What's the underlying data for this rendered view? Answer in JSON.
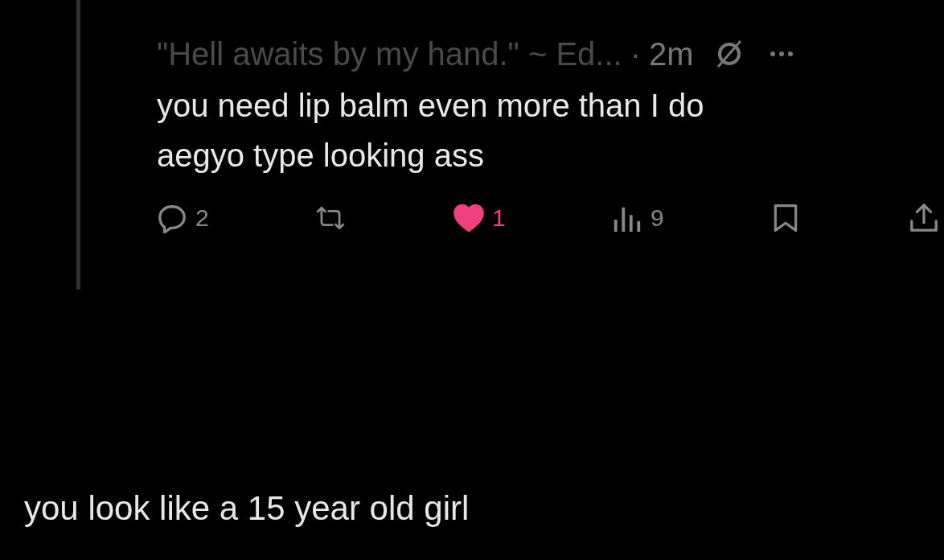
{
  "post": {
    "author": "\"Hell awaits by my hand.\" ~ Ed...",
    "separator": "·",
    "time": "2m",
    "text_lines": [
      "you need lip balm even more than I do",
      "aegyo type looking ass"
    ],
    "actions": [
      {
        "kind": "reply",
        "count": "2"
      },
      {
        "kind": "repost"
      },
      {
        "kind": "like",
        "count": "1",
        "selected": true
      },
      {
        "kind": "views",
        "count": "9"
      },
      {
        "kind": "bookmark"
      },
      {
        "kind": "share"
      }
    ]
  },
  "caption": "you look like a 15 year old girl"
}
